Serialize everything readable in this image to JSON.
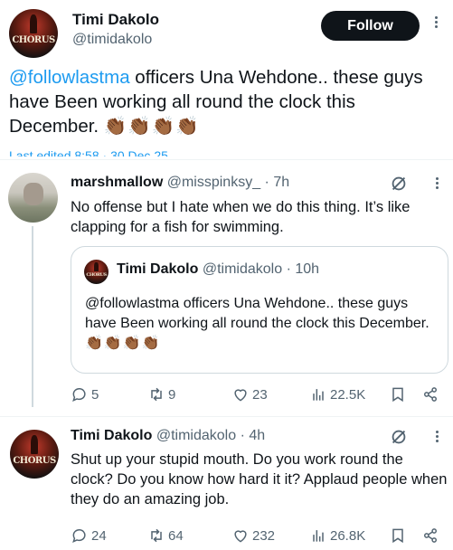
{
  "main_tweet": {
    "name": "Timi Dakolo",
    "handle": "@timidakolo",
    "follow_label": "Follow",
    "avatar_text": "CHORUS",
    "text_mention": "@followlastma",
    "text_body": " officers Una Wehdone.. these guys have Been working all round the clock this December.",
    "text_emoji": "👏🏾👏🏾👏🏾👏🏾",
    "last_edited": "Last edited 8:58 · 30 Dec 25"
  },
  "reply1": {
    "name": "marshmallow",
    "handle": "@misspinksy_",
    "time": "· 7h",
    "text": "No offense but I hate when we do this thing. It’s like clapping for a fish for swimming.",
    "quote": {
      "name": "Timi Dakolo",
      "handle": "@timidakolo",
      "time": "· 10h",
      "avatar_text": "CHORUS",
      "text": "@followlastma officers Una Wehdone.. these guys have Been working all round the clock this December.",
      "text_emoji": "👏🏾👏🏾👏🏾👏🏾"
    },
    "stats": {
      "replies": "5",
      "reposts": "9",
      "likes": "23",
      "views": "22.5K"
    }
  },
  "reply2": {
    "name": "Timi Dakolo",
    "handle": "@timidakolo",
    "time": "· 4h",
    "avatar_text": "CHORUS",
    "text": "Shut  up your stupid mouth. Do you work round the clock? Do you know how hard it it? Applaud people when they do an amazing job.",
    "stats": {
      "replies": "24",
      "reposts": "64",
      "likes": "232",
      "views": "26.8K"
    }
  },
  "icons": [
    "reply-icon",
    "repost-icon",
    "like-icon",
    "views-icon",
    "bookmark-icon",
    "share-icon",
    "grok-icon",
    "more-icon"
  ],
  "colors": {
    "accent": "#1d9bf0",
    "text": "#0f1419",
    "muted": "#536471",
    "follow_bg": "#0f1419"
  }
}
